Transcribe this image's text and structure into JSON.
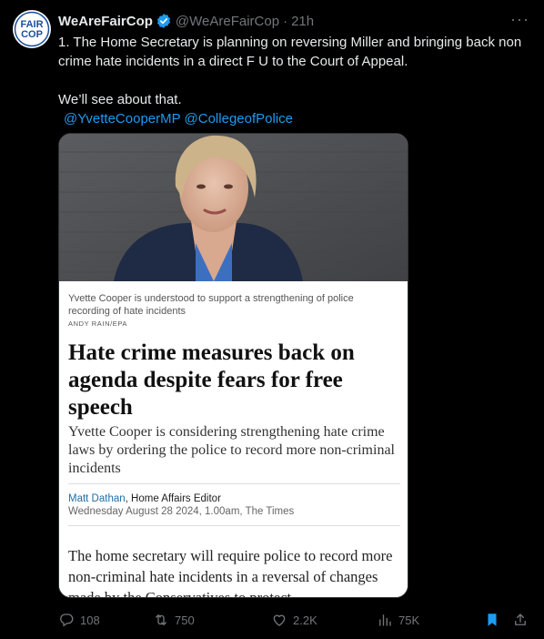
{
  "author": {
    "display_name": "WeAreFairCop",
    "handle": "@WeAreFairCop",
    "separator": "·",
    "time": "21h",
    "avatar_text": [
      "FAIR",
      "COP"
    ],
    "verified": true
  },
  "tweet": {
    "line1": "1. The Home Secretary is planning on reversing Miller and bringing back non crime hate incidents in a direct F U  to the Court of Appeal.",
    "line2": "We’ll see about that.",
    "mentions": [
      "@YvetteCooperMP",
      "@CollegeofPolice"
    ]
  },
  "article": {
    "caption": "Yvette Cooper is understood to support a strengthening of police recording of hate incidents",
    "credit": "ANDY RAIN/EPA",
    "headline": "Hate crime measures back on agenda despite fears for free speech",
    "standfirst": "Yvette Cooper is considering strengthening hate crime laws by ordering the police to record more non-criminal incidents",
    "author_name": "Matt Dathan",
    "author_role": ", Home Affairs Editor",
    "dateline": "Wednesday August 28 2024, 1.00am, The Times",
    "body": "The home secretary will require police to record more non-criminal hate incidents in a reversal of changes made by the Conservatives to protect"
  },
  "actions": {
    "replies": "108",
    "reposts": "750",
    "likes": "2.2K",
    "views": "75K",
    "icons": [
      "reply-icon",
      "retweet-icon",
      "heart-icon",
      "views-icon",
      "bookmark-icon",
      "share-icon"
    ]
  },
  "colors": {
    "background": "#000000",
    "text": "#e7e9ea",
    "muted": "#71767b",
    "link": "#1d9bf0",
    "verified": "#1d9bf0",
    "bookmark_active": "#1d9bf0"
  }
}
